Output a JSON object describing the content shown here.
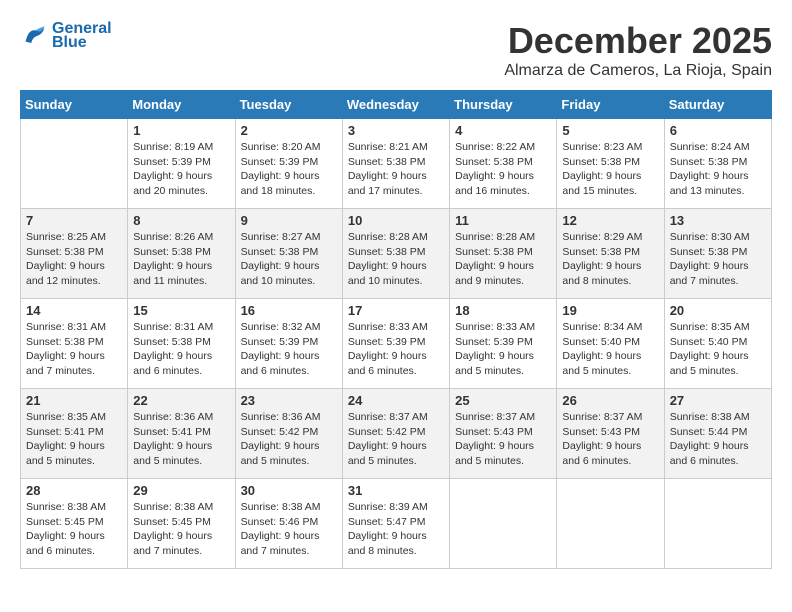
{
  "logo": {
    "text_general": "General",
    "text_blue": "Blue"
  },
  "header": {
    "month": "December 2025",
    "location": "Almarza de Cameros, La Rioja, Spain"
  },
  "days_of_week": [
    "Sunday",
    "Monday",
    "Tuesday",
    "Wednesday",
    "Thursday",
    "Friday",
    "Saturday"
  ],
  "weeks": [
    [
      {
        "day": "",
        "info": ""
      },
      {
        "day": "1",
        "info": "Sunrise: 8:19 AM\nSunset: 5:39 PM\nDaylight: 9 hours\nand 20 minutes."
      },
      {
        "day": "2",
        "info": "Sunrise: 8:20 AM\nSunset: 5:39 PM\nDaylight: 9 hours\nand 18 minutes."
      },
      {
        "day": "3",
        "info": "Sunrise: 8:21 AM\nSunset: 5:38 PM\nDaylight: 9 hours\nand 17 minutes."
      },
      {
        "day": "4",
        "info": "Sunrise: 8:22 AM\nSunset: 5:38 PM\nDaylight: 9 hours\nand 16 minutes."
      },
      {
        "day": "5",
        "info": "Sunrise: 8:23 AM\nSunset: 5:38 PM\nDaylight: 9 hours\nand 15 minutes."
      },
      {
        "day": "6",
        "info": "Sunrise: 8:24 AM\nSunset: 5:38 PM\nDaylight: 9 hours\nand 13 minutes."
      }
    ],
    [
      {
        "day": "7",
        "info": "Sunrise: 8:25 AM\nSunset: 5:38 PM\nDaylight: 9 hours\nand 12 minutes."
      },
      {
        "day": "8",
        "info": "Sunrise: 8:26 AM\nSunset: 5:38 PM\nDaylight: 9 hours\nand 11 minutes."
      },
      {
        "day": "9",
        "info": "Sunrise: 8:27 AM\nSunset: 5:38 PM\nDaylight: 9 hours\nand 10 minutes."
      },
      {
        "day": "10",
        "info": "Sunrise: 8:28 AM\nSunset: 5:38 PM\nDaylight: 9 hours\nand 10 minutes."
      },
      {
        "day": "11",
        "info": "Sunrise: 8:28 AM\nSunset: 5:38 PM\nDaylight: 9 hours\nand 9 minutes."
      },
      {
        "day": "12",
        "info": "Sunrise: 8:29 AM\nSunset: 5:38 PM\nDaylight: 9 hours\nand 8 minutes."
      },
      {
        "day": "13",
        "info": "Sunrise: 8:30 AM\nSunset: 5:38 PM\nDaylight: 9 hours\nand 7 minutes."
      }
    ],
    [
      {
        "day": "14",
        "info": "Sunrise: 8:31 AM\nSunset: 5:38 PM\nDaylight: 9 hours\nand 7 minutes."
      },
      {
        "day": "15",
        "info": "Sunrise: 8:31 AM\nSunset: 5:38 PM\nDaylight: 9 hours\nand 6 minutes."
      },
      {
        "day": "16",
        "info": "Sunrise: 8:32 AM\nSunset: 5:39 PM\nDaylight: 9 hours\nand 6 minutes."
      },
      {
        "day": "17",
        "info": "Sunrise: 8:33 AM\nSunset: 5:39 PM\nDaylight: 9 hours\nand 6 minutes."
      },
      {
        "day": "18",
        "info": "Sunrise: 8:33 AM\nSunset: 5:39 PM\nDaylight: 9 hours\nand 5 minutes."
      },
      {
        "day": "19",
        "info": "Sunrise: 8:34 AM\nSunset: 5:40 PM\nDaylight: 9 hours\nand 5 minutes."
      },
      {
        "day": "20",
        "info": "Sunrise: 8:35 AM\nSunset: 5:40 PM\nDaylight: 9 hours\nand 5 minutes."
      }
    ],
    [
      {
        "day": "21",
        "info": "Sunrise: 8:35 AM\nSunset: 5:41 PM\nDaylight: 9 hours\nand 5 minutes."
      },
      {
        "day": "22",
        "info": "Sunrise: 8:36 AM\nSunset: 5:41 PM\nDaylight: 9 hours\nand 5 minutes."
      },
      {
        "day": "23",
        "info": "Sunrise: 8:36 AM\nSunset: 5:42 PM\nDaylight: 9 hours\nand 5 minutes."
      },
      {
        "day": "24",
        "info": "Sunrise: 8:37 AM\nSunset: 5:42 PM\nDaylight: 9 hours\nand 5 minutes."
      },
      {
        "day": "25",
        "info": "Sunrise: 8:37 AM\nSunset: 5:43 PM\nDaylight: 9 hours\nand 5 minutes."
      },
      {
        "day": "26",
        "info": "Sunrise: 8:37 AM\nSunset: 5:43 PM\nDaylight: 9 hours\nand 6 minutes."
      },
      {
        "day": "27",
        "info": "Sunrise: 8:38 AM\nSunset: 5:44 PM\nDaylight: 9 hours\nand 6 minutes."
      }
    ],
    [
      {
        "day": "28",
        "info": "Sunrise: 8:38 AM\nSunset: 5:45 PM\nDaylight: 9 hours\nand 6 minutes."
      },
      {
        "day": "29",
        "info": "Sunrise: 8:38 AM\nSunset: 5:45 PM\nDaylight: 9 hours\nand 7 minutes."
      },
      {
        "day": "30",
        "info": "Sunrise: 8:38 AM\nSunset: 5:46 PM\nDaylight: 9 hours\nand 7 minutes."
      },
      {
        "day": "31",
        "info": "Sunrise: 8:39 AM\nSunset: 5:47 PM\nDaylight: 9 hours\nand 8 minutes."
      },
      {
        "day": "",
        "info": ""
      },
      {
        "day": "",
        "info": ""
      },
      {
        "day": "",
        "info": ""
      }
    ]
  ]
}
